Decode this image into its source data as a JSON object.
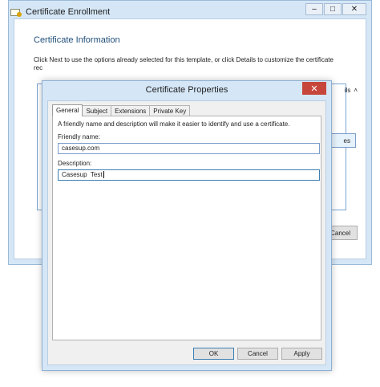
{
  "bg_window": {
    "caption_buttons": {
      "minimize": "–",
      "maximize": "□",
      "close": "✕"
    },
    "title": "Certificate Enrollment",
    "section_title": "Certificate Information",
    "description_line1": "Click Next to use the options already selected for this template, or click Details to customize the certificate",
    "description_line2": "rec",
    "details_label": "ils",
    "details_chevron": "˄",
    "properties_button": "es",
    "cancel_button": "Cancel"
  },
  "dialog": {
    "title": "Certificate Properties",
    "close_glyph": "✕",
    "tabs": [
      "General",
      "Subject",
      "Extensions",
      "Private Key"
    ],
    "intro": "A friendly name and description will make it easier to identify and use a certificate.",
    "friendly_name_label": "Friendly name:",
    "friendly_name_value": "casesup.com",
    "description_label": "Description:",
    "description_value": "Casesup  Test",
    "buttons": {
      "ok": "OK",
      "cancel": "Cancel",
      "apply": "Apply"
    }
  }
}
